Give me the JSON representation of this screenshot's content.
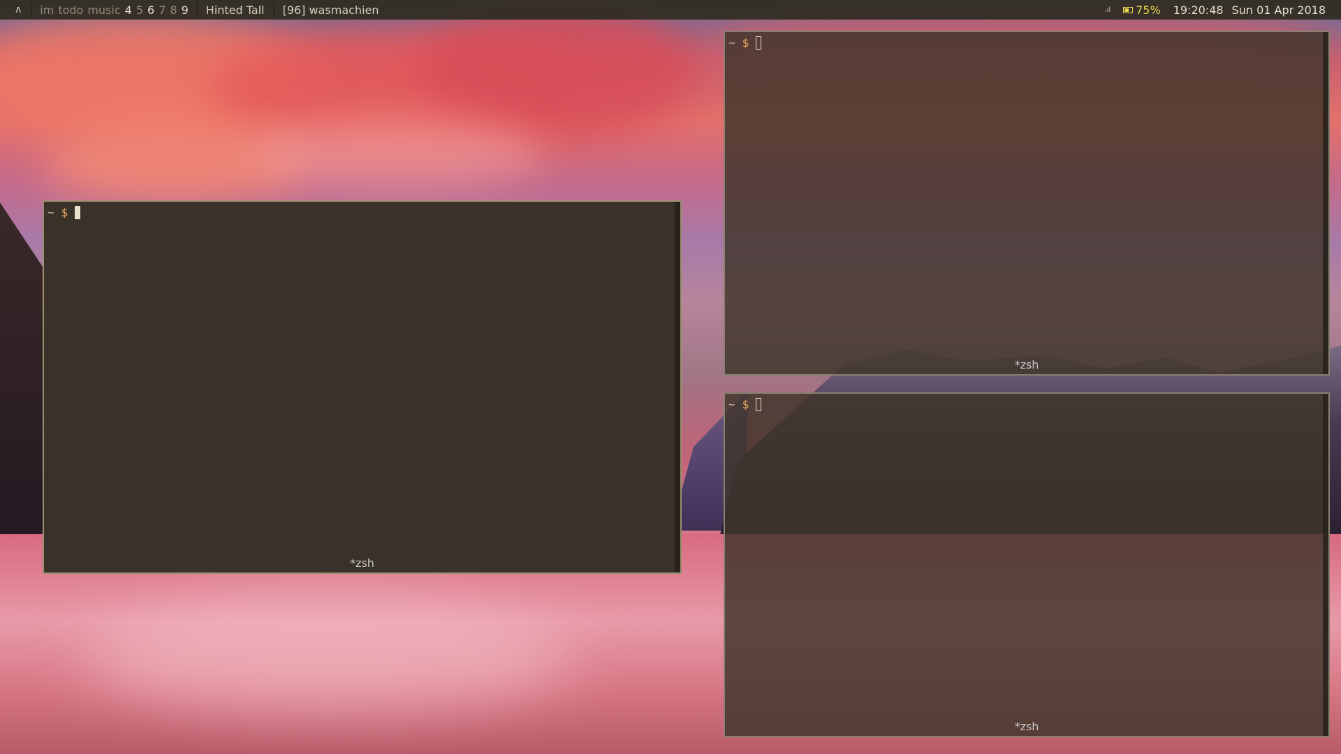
{
  "topbar": {
    "launcher_glyph": "ʌ",
    "workspaces": [
      {
        "label": "im",
        "state": "inactive"
      },
      {
        "label": "todo",
        "state": "inactive"
      },
      {
        "label": "music",
        "state": "inactive"
      },
      {
        "label": "4",
        "state": "occupied"
      },
      {
        "label": "5",
        "state": "inactive"
      },
      {
        "label": "6",
        "state": "occupied"
      },
      {
        "label": "7",
        "state": "inactive"
      },
      {
        "label": "8",
        "state": "inactive"
      },
      {
        "label": "9",
        "state": "occupied"
      }
    ],
    "layout": "Hinted Tall",
    "window_title": "[96] wasmachien",
    "signal_glyph": ".ıl",
    "battery": "75%",
    "time": "19:20:48",
    "date": "Sun 01 Apr 2018"
  },
  "terminals": [
    {
      "id": "main",
      "prompt_tilde": "~",
      "prompt_symbol": "$",
      "tab_label": "*zsh",
      "focused": true
    },
    {
      "id": "top",
      "prompt_tilde": "~",
      "prompt_symbol": "$",
      "tab_label": "*zsh",
      "focused": false
    },
    {
      "id": "bottom",
      "prompt_tilde": "~",
      "prompt_symbol": "$",
      "tab_label": "*zsh",
      "focused": false
    }
  ],
  "colors": {
    "bar_bg": "#322e24",
    "terminal_bg": "#3a3128",
    "prompt_dollar": "#e8a860",
    "battery": "#e6d24e",
    "active_border": "#9a906f"
  },
  "icons": {
    "launcher": "arch-launcher-icon",
    "signal": "signal-icon",
    "battery": "battery-icon"
  }
}
